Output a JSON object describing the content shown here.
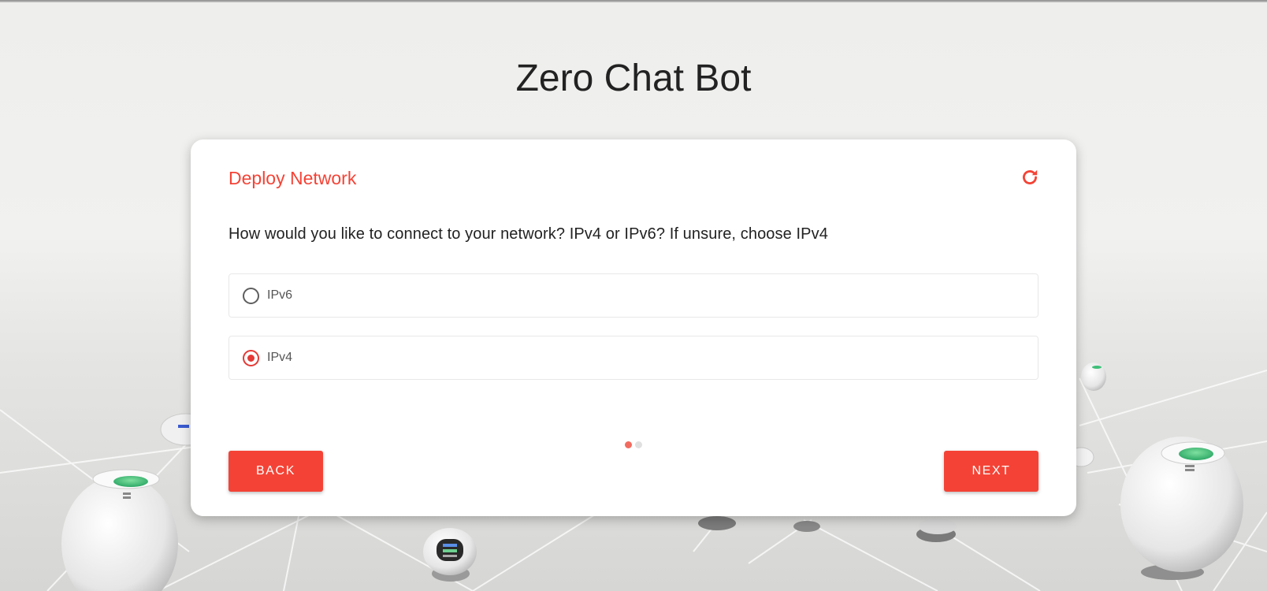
{
  "app": {
    "title": "Zero Chat Bot"
  },
  "card": {
    "title": "Deploy Network",
    "refresh_icon": "refresh-icon",
    "question": "How would you like to connect to your network? IPv4 or IPv6? If unsure, choose IPv4",
    "options": [
      {
        "label": "IPv6",
        "selected": false
      },
      {
        "label": "IPv4",
        "selected": true
      }
    ],
    "steps": {
      "current": 1,
      "total": 2
    },
    "back_label": "BACK",
    "next_label": "NEXT"
  },
  "colors": {
    "accent": "#f44336",
    "radio_selected": "#e53935",
    "title_text": "#222222"
  }
}
